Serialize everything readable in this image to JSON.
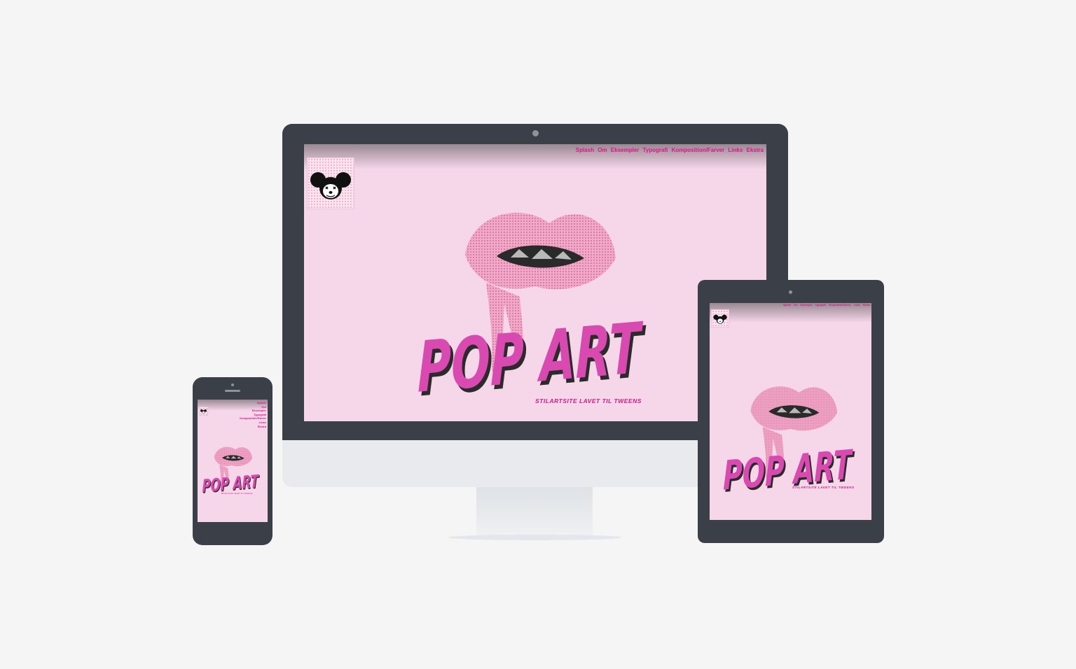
{
  "site": {
    "nav": [
      "Splash",
      "Om",
      "Eksempler",
      "Typografi",
      "Komposition/Farver",
      "Links",
      "Ekstra"
    ],
    "hero_title": "POP ART",
    "tagline": "STILARTSITE LAVET TIL TWEENS",
    "tagline_phone": "Stilartsite lavet til tweens"
  },
  "colors": {
    "page_background": "#f5f5f5",
    "device_frame": "#3a3f48",
    "screen_background": "#f6d7ea",
    "accent_magenta": "#e0148a",
    "lips_pink": "#f0a9c7"
  },
  "icons": {
    "logo": "mouse-face-icon"
  }
}
